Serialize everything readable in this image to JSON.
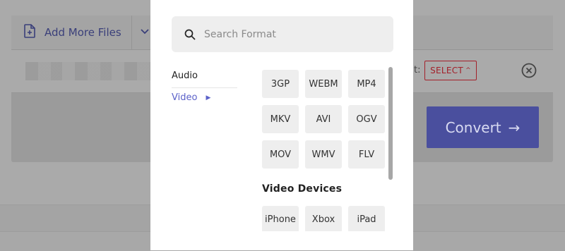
{
  "background_app": {
    "add_files_label": "Add More Files",
    "to_label": "t:",
    "select_label": "SELECT",
    "convert_label": "Convert"
  },
  "modal": {
    "search": {
      "placeholder": "Search Format",
      "value": ""
    },
    "categories": [
      {
        "label": "Audio",
        "active": false
      },
      {
        "label": "Video",
        "active": true
      }
    ],
    "formats": [
      "3GP",
      "WEBM",
      "MP4",
      "MKV",
      "AVI",
      "OGV",
      "MOV",
      "WMV",
      "FLV"
    ],
    "devices_title": "Video Devices",
    "devices": [
      "iPhone",
      "Xbox",
      "iPad"
    ]
  },
  "colors": {
    "accent": "#5b61c9",
    "select_red": "#a3202a",
    "convert_bg": "#4a4f9e"
  },
  "icons": [
    "file-add-icon",
    "chevron-down-icon",
    "remove-icon",
    "search-icon",
    "caret-right-icon",
    "arrow-right-icon"
  ]
}
